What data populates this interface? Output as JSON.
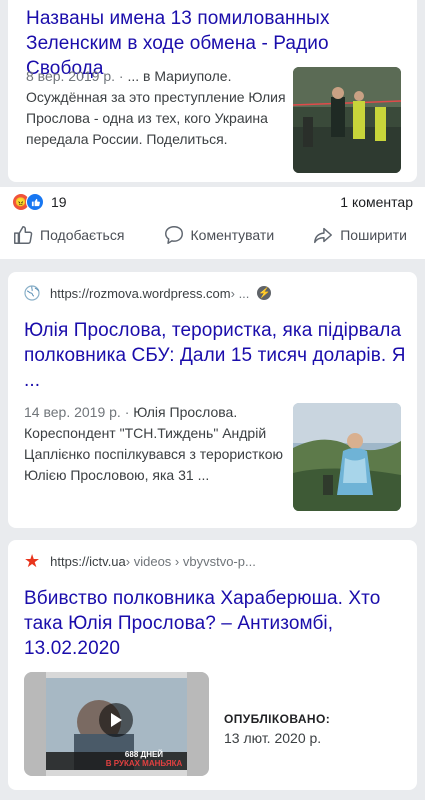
{
  "result1": {
    "title": "Названы имена 13 помилованных Зеленским в ходе обмена - Радио Свобода",
    "date": "8 вер. 2019 р. · ",
    "snippet": "... в Мариуполе. Осуждённая за это преступление Юлия Прословa - одна из тех, кого Украина передала России. Поделиться."
  },
  "facebook": {
    "reaction_count": "19",
    "comments": "1 коментар",
    "like": "Подобається",
    "comment": "Коментувати",
    "share": "Поширити"
  },
  "result2": {
    "url": "https://rozmova.wordpress.com",
    "url_path": " › ...",
    "title": "Юлія Прослова, терористка, яка підірвала полковника СБУ: Дали 15 тисяч доларів. Я ...",
    "date": "14 вер. 2019 р. · ",
    "snippet": "Юлія Прослова. Кореспондент \"ТСН.Тиждень\" Андрій Цаплієнко поспілкувався з терористкою Юлією Прословою, яка 31 ..."
  },
  "result3": {
    "url": "https://ictv.ua",
    "url_path": " › videos › vbyvstvo-p...",
    "title": "Вбивство полковника Хараберюша. Хто така Юлія Прослова? – Антизомбі, 13.02.2020",
    "published_label": "ОПУБЛІКОВАНО:",
    "published_date": "13 лют. 2020 р.",
    "video_caption_1": "688 ДНЕЙ",
    "video_caption_2": "В РУКАХ МАНЬЯКА"
  },
  "colors": {
    "link": "#1a0dab",
    "fb_blue": "#1877f2",
    "angry": "#f0533a"
  }
}
